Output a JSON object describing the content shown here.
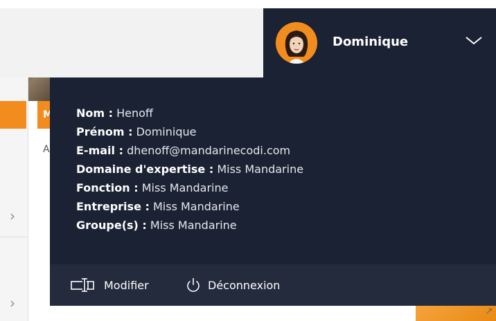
{
  "user": {
    "name": "Dominique"
  },
  "profile": {
    "rows": [
      {
        "label": "Nom :",
        "value": "Henoff"
      },
      {
        "label": "Prénom :",
        "value": "Dominique"
      },
      {
        "label": "E-mail :",
        "value": "dhenoff@mandarinecodi.com"
      },
      {
        "label": "Domaine d'expertise :",
        "value": "Miss Mandarine"
      },
      {
        "label": "Fonction :",
        "value": "Miss Mandarine"
      },
      {
        "label": "Entreprise :",
        "value": "Miss Mandarine"
      },
      {
        "label": "Groupe(s) :",
        "value": "Miss Mandarine"
      }
    ]
  },
  "actions": {
    "edit_label": "Modifier",
    "logout_label": "Déconnexion"
  },
  "background": {
    "partial_letter_1": "M",
    "partial_letter_2": "A"
  },
  "colors": {
    "panel": "#1b2233",
    "footer": "#232b3c",
    "accent": "#f28c1e"
  },
  "icons": {
    "edit": "edit-field-icon",
    "logout": "power-icon",
    "chevron": "chevron-down-icon"
  }
}
